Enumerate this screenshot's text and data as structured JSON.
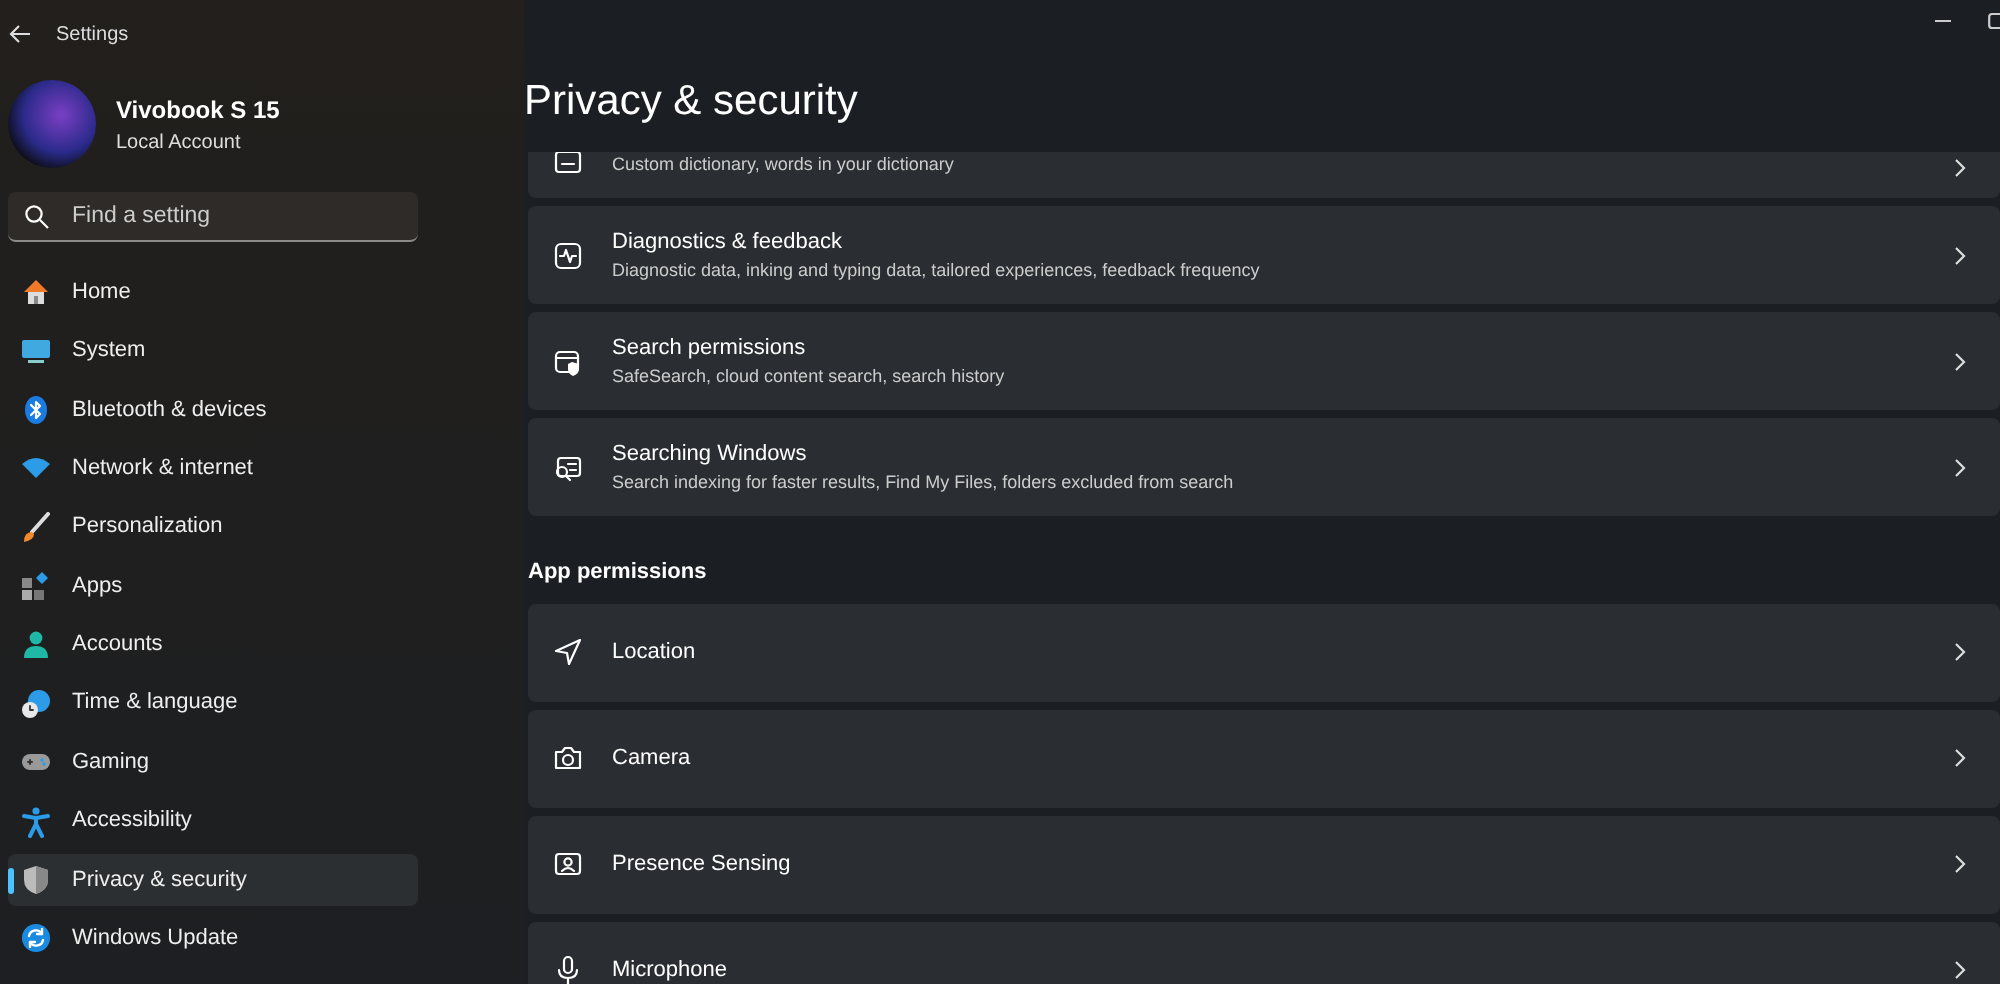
{
  "window": {
    "title": "Settings"
  },
  "account": {
    "name": "Vivobook S 15",
    "type": "Local Account"
  },
  "search": {
    "placeholder": "Find a setting"
  },
  "sidebar": {
    "items": [
      {
        "label": "Home",
        "kind": "home",
        "selected": false
      },
      {
        "label": "System",
        "kind": "system",
        "selected": false
      },
      {
        "label": "Bluetooth & devices",
        "kind": "bluetooth",
        "selected": false
      },
      {
        "label": "Network & internet",
        "kind": "network",
        "selected": false
      },
      {
        "label": "Personalization",
        "kind": "brush",
        "selected": false
      },
      {
        "label": "Apps",
        "kind": "apps",
        "selected": false
      },
      {
        "label": "Accounts",
        "kind": "person",
        "selected": false
      },
      {
        "label": "Time & language",
        "kind": "time",
        "selected": false
      },
      {
        "label": "Gaming",
        "kind": "gaming",
        "selected": false
      },
      {
        "label": "Accessibility",
        "kind": "accessibility",
        "selected": false
      },
      {
        "label": "Privacy & security",
        "kind": "shield",
        "selected": true
      },
      {
        "label": "Windows Update",
        "kind": "update",
        "selected": false
      }
    ]
  },
  "page": {
    "title": "Privacy & security"
  },
  "sections": [
    {
      "items": [
        {
          "kind": "dictionary",
          "description": "Custom dictionary, words in your dictionary"
        },
        {
          "kind": "diagnostics",
          "title": "Diagnostics & feedback",
          "description": "Diagnostic data, inking and typing data, tailored experiences, feedback frequency"
        },
        {
          "kind": "searchperm",
          "title": "Search permissions",
          "description": "SafeSearch, cloud content search, search history"
        },
        {
          "kind": "searchwin",
          "title": "Searching Windows",
          "description": "Search indexing for faster results, Find My Files, folders excluded from search"
        }
      ]
    },
    {
      "heading": "App permissions",
      "items": [
        {
          "kind": "location",
          "title": "Location"
        },
        {
          "kind": "camera",
          "title": "Camera"
        },
        {
          "kind": "presence",
          "title": "Presence Sensing"
        },
        {
          "kind": "microphone",
          "title": "Microphone"
        }
      ]
    }
  ]
}
